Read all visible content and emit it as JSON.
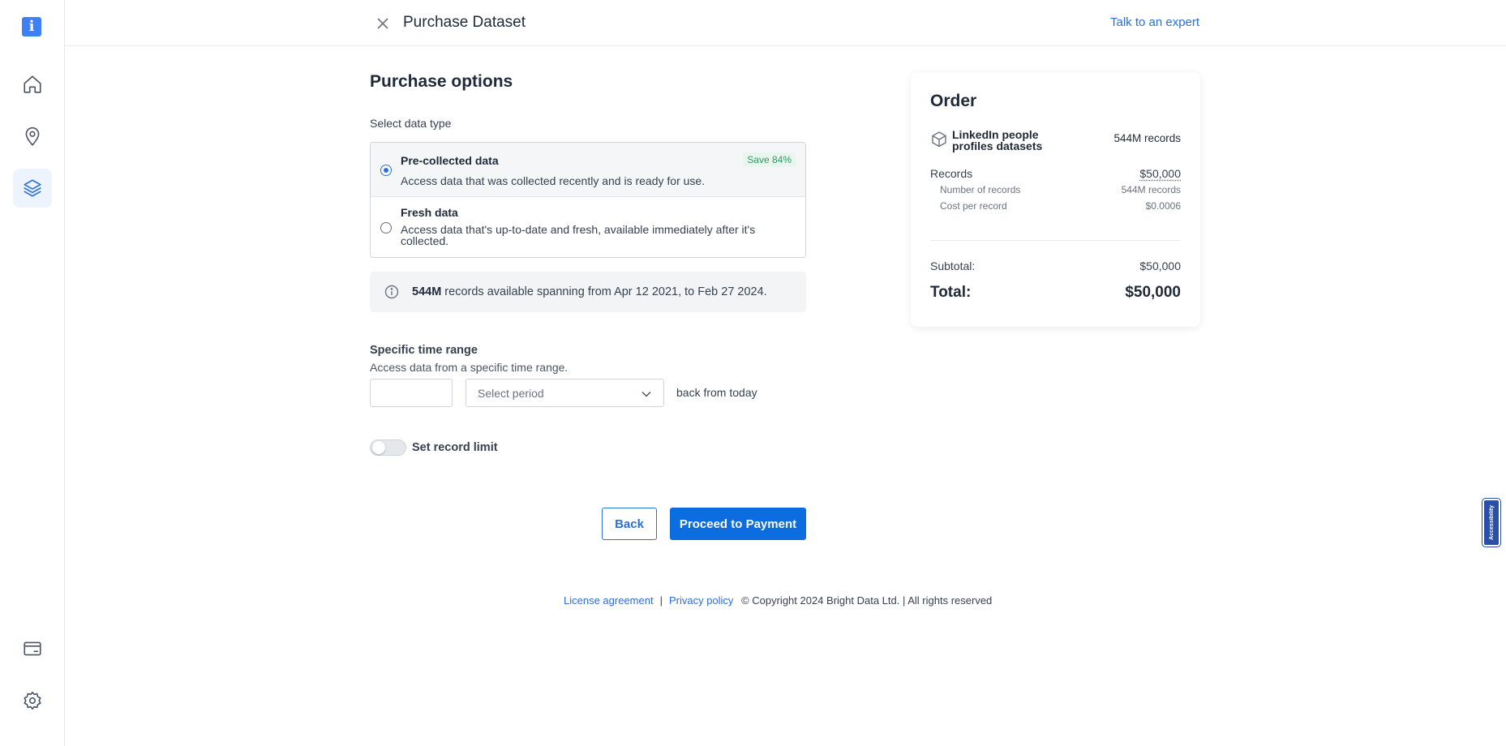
{
  "sidebar": {
    "logo_glyph": "i",
    "items": [
      {
        "name": "home-icon",
        "active": false
      },
      {
        "name": "location-pin-icon",
        "active": false
      },
      {
        "name": "datasets-stack-icon",
        "active": true
      },
      {
        "name": "billing-card-icon",
        "active": false
      },
      {
        "name": "settings-gear-icon",
        "active": false
      }
    ]
  },
  "header": {
    "title": "Purchase Dataset",
    "expert_link": "Talk to an expert"
  },
  "purchase": {
    "section_title": "Purchase options",
    "select_label": "Select data type",
    "options": [
      {
        "title": "Pre-collected data",
        "description": "Access data that was collected recently and is ready for use.",
        "badge": "Save 84%",
        "selected": true
      },
      {
        "title": "Fresh data",
        "description": "Access data that's up-to-date and fresh, available immediately after it's collected.",
        "selected": false
      }
    ],
    "info": {
      "count": "544M",
      "text": " records available spanning from Apr 12 2021, to Feb 27 2024."
    },
    "time_range": {
      "title": "Specific time range",
      "description": "Access data from a specific time range.",
      "number_value": "",
      "period_placeholder": "Select period",
      "suffix": "back from today"
    },
    "record_limit": {
      "label": "Set record limit",
      "enabled": false
    },
    "buttons": {
      "back": "Back",
      "proceed": "Proceed to Payment"
    }
  },
  "order": {
    "title": "Order",
    "dataset_name": "LinkedIn people profiles datasets",
    "dataset_records": "544M records",
    "records_label": "Records",
    "records_value": "$50,000",
    "num_records_label": "Number of records",
    "num_records_value": "544M records",
    "cost_label": "Cost per record",
    "cost_value": "$0.0006",
    "subtotal_label": "Subtotal:",
    "subtotal_value": "$50,000",
    "total_label": "Total:",
    "total_value": "$50,000"
  },
  "footer": {
    "license": "License agreement",
    "separator": "|",
    "privacy": "Privacy policy",
    "copyright": "© Copyright 2024 Bright Data Ltd. | All rights reserved"
  },
  "accessibility_button": "Accessibility",
  "colors": {
    "accent": "#2a6fdb",
    "primary_button": "#0b6ddf",
    "badge_text": "#2f9a62",
    "badge_bg": "#e8f6ee"
  }
}
